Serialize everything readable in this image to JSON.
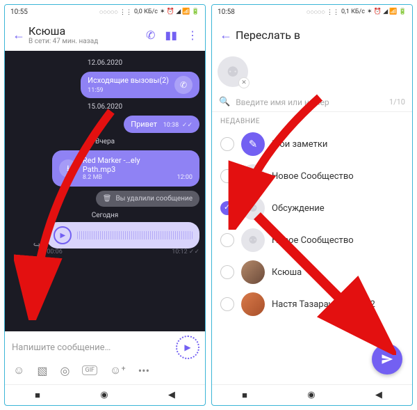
{
  "left": {
    "status": {
      "time": "10:55",
      "net": "0,0 КБ/с"
    },
    "header": {
      "title": "Ксюша",
      "subtitle": "В сети: 47 мин. назад"
    },
    "dates": {
      "d1": "12.06.2020",
      "d2": "15.06.2020",
      "d3": "Вчера",
      "d4": "Сегодня"
    },
    "call": {
      "label": "Исходящие вызовы(2)",
      "time": "11:59"
    },
    "hello": {
      "text": "Привет",
      "time": "10:38"
    },
    "file": {
      "name": "Red Marker -…ely Path.mp3",
      "size": "8.2 MB",
      "time": "12:00"
    },
    "deleted": {
      "text": "Вы удалили сообщение"
    },
    "voice": {
      "dur": "00:06",
      "time": "10:12"
    },
    "composer": {
      "placeholder": "Напишите сообщение…",
      "gif": "GIF"
    }
  },
  "right": {
    "status": {
      "time": "10:58",
      "net": "0,1 КБ/с"
    },
    "header": {
      "title": "Переслать в"
    },
    "search": {
      "placeholder": "Введите имя или номер",
      "count": "1/10"
    },
    "section": "НЕДАВНИЕ",
    "items": [
      {
        "name": "Мои заметки"
      },
      {
        "name": "Новое Сообщество"
      },
      {
        "name": "Обсуждение"
      },
      {
        "name": "Новое Сообщество"
      },
      {
        "name": "Ксюша"
      },
      {
        "name": "Настя Тазарачева Теле2"
      }
    ]
  }
}
